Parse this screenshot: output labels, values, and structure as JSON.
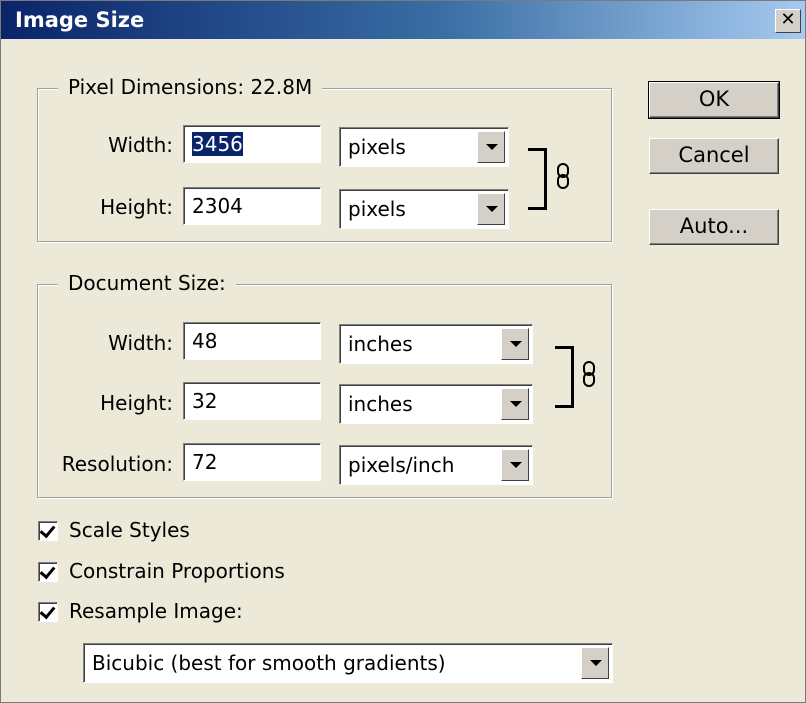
{
  "window": {
    "title": "Image Size",
    "close_glyph": "✕"
  },
  "pixel_dimensions": {
    "legend": "Pixel Dimensions:  22.8M",
    "width_label": "Width:",
    "width_value": "3456",
    "width_unit": "pixels",
    "height_label": "Height:",
    "height_value": "2304",
    "height_unit": "pixels"
  },
  "document_size": {
    "legend": "Document Size:",
    "width_label": "Width:",
    "width_value": "48",
    "width_unit": "inches",
    "height_label": "Height:",
    "height_value": "32",
    "height_unit": "inches",
    "resolution_label": "Resolution:",
    "resolution_value": "72",
    "resolution_unit": "pixels/inch"
  },
  "buttons": {
    "ok": "OK",
    "cancel": "Cancel",
    "auto": "Auto..."
  },
  "options": {
    "scale_styles": {
      "label": "Scale Styles",
      "checked": true
    },
    "constrain_proportions": {
      "label": "Constrain Proportions",
      "checked": true
    },
    "resample_image": {
      "label": "Resample Image:",
      "checked": true
    }
  },
  "resample_method": "Bicubic (best for smooth gradients)",
  "icons": {
    "link": "chain-link-icon",
    "dropdown": "dropdown-arrow-icon",
    "check": "checkmark-icon"
  }
}
